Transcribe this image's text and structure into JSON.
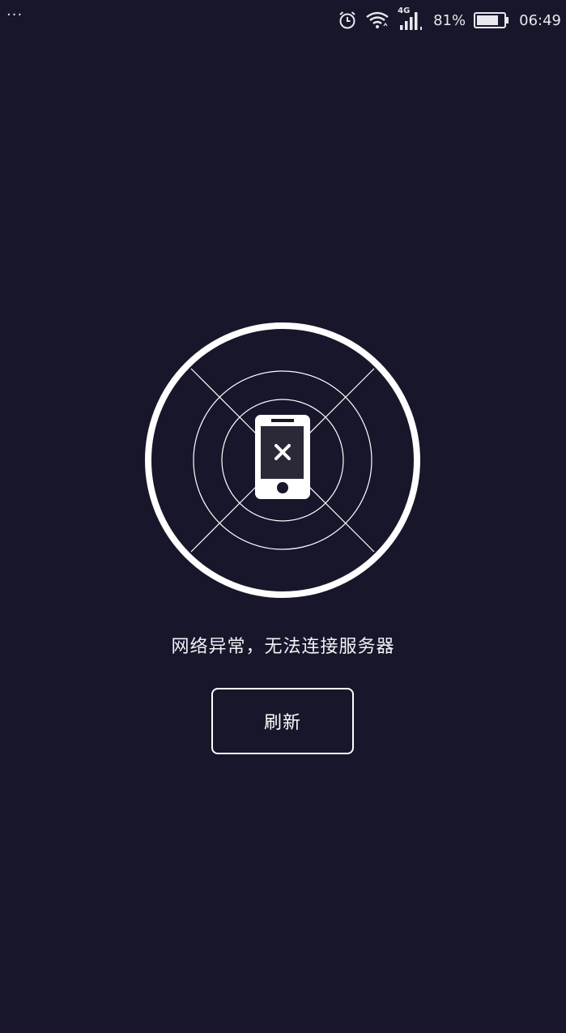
{
  "status_bar": {
    "menu_dots": "···",
    "network_type": "4G",
    "battery_percent": "81%",
    "battery_level": 0.81,
    "time": "06:49",
    "icons": [
      "alarm-icon",
      "wifi-icon",
      "cellular-signal-icon",
      "battery-icon"
    ]
  },
  "error": {
    "icon": "phone-disconnected-icon",
    "message": "网络异常，无法连接服务器"
  },
  "actions": {
    "refresh_label": "刷新"
  },
  "colors": {
    "background": "#17162a",
    "foreground": "#ffffff",
    "phone_screen": "#2b2838"
  }
}
